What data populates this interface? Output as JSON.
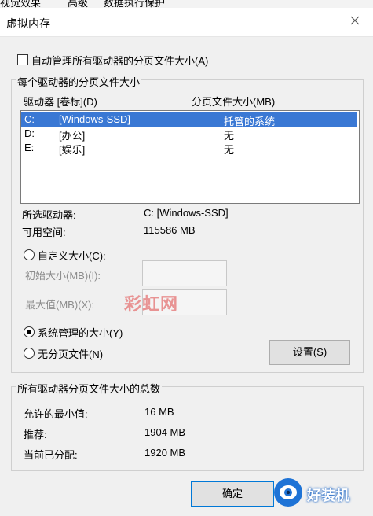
{
  "background_tabs": [
    "视觉效果",
    "高级",
    "数据执行保护"
  ],
  "window": {
    "title": "虚拟内存",
    "close_icon": "close-icon"
  },
  "auto_manage": {
    "label": "自动管理所有驱动器的分页文件大小(A)",
    "checked": false
  },
  "per_drive": {
    "group_title": "每个驱动器的分页文件大小",
    "col_drive": "驱动器 [卷标](D)",
    "col_size": "分页文件大小(MB)",
    "rows": [
      {
        "drive": "C:",
        "label": "[Windows-SSD]",
        "size": "托管的系统",
        "selected": true
      },
      {
        "drive": "D:",
        "label": "[办公]",
        "size": "无",
        "selected": false
      },
      {
        "drive": "E:",
        "label": "[娱乐]",
        "size": "无",
        "selected": false
      }
    ],
    "selected_drive_label": "所选驱动器:",
    "selected_drive_value": "C:  [Windows-SSD]",
    "free_space_label": "可用空间:",
    "free_space_value": "115586 MB",
    "custom_size_label": "自定义大小(C):",
    "initial_size_label": "初始大小(MB)(I):",
    "max_size_label": "最大值(MB)(X):",
    "initial_size_value": "",
    "max_size_value": "",
    "system_managed_label": "系统管理的大小(Y)",
    "no_paging_label": "无分页文件(N)",
    "selected_option": "system_managed",
    "set_button": "设置(S)"
  },
  "totals": {
    "group_title": "所有驱动器分页文件大小的总数",
    "min_label": "允许的最小值:",
    "min_value": "16 MB",
    "recommended_label": "推荐:",
    "recommended_value": "1904 MB",
    "allocated_label": "当前已分配:",
    "allocated_value": "1920 MB"
  },
  "ok_button": "确定",
  "watermark": "彩虹网",
  "logo": {
    "text": "好装机",
    "icon": "logo-eye-icon",
    "color": "#1e73d6"
  },
  "colors": {
    "selection": "#3a78d4",
    "watermark": "#e89393"
  }
}
